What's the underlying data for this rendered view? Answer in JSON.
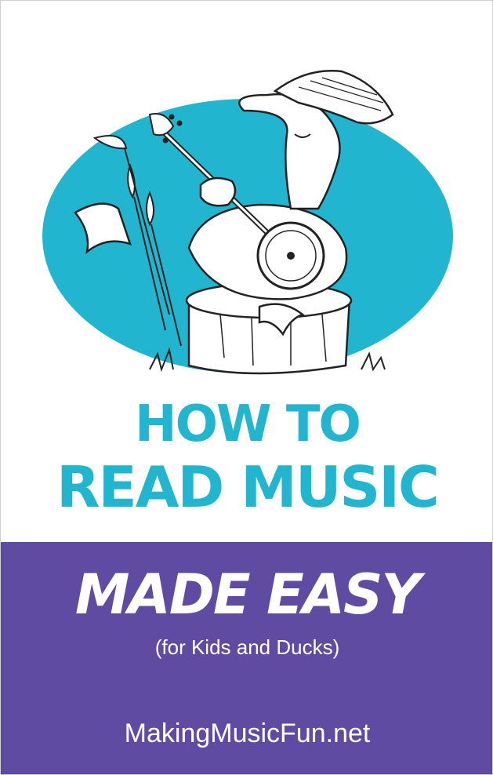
{
  "book": {
    "title_line1": "How To",
    "title_line2": "Read Music",
    "subtitle": "Made Easy",
    "tagline": "(for Kids and Ducks)",
    "website": "MakingMusicFun.net"
  },
  "colors": {
    "teal": "#21b5cf",
    "purple": "#604ba2",
    "white": "#ffffff",
    "ink": "#222222"
  },
  "illustration": {
    "icon": "duck-playing-banjo-illustration"
  }
}
